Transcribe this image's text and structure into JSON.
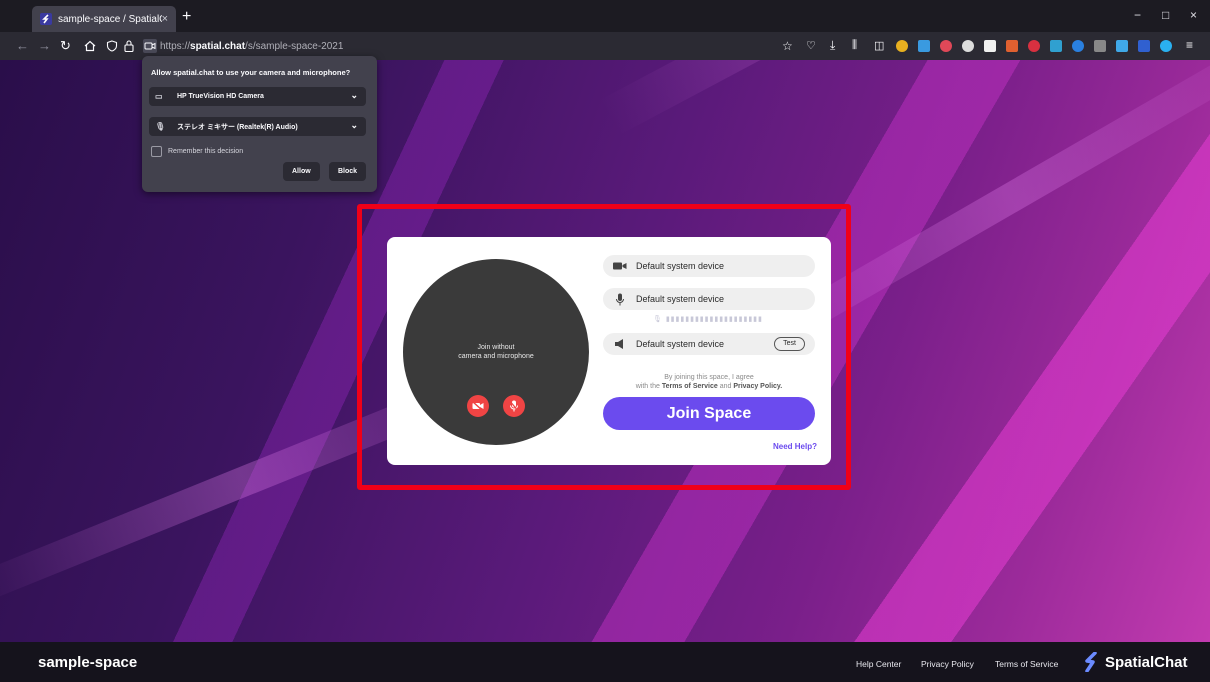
{
  "browser": {
    "tab_title": "sample-space / SpatialChat",
    "tab_close": "×",
    "new_tab": "+",
    "url_prefix": "https://",
    "url_host": "spatial.chat",
    "url_path": "/s/sample-space-2021",
    "window_controls": {
      "minimize": "−",
      "maximize": "□",
      "close": "×"
    }
  },
  "permission_popup": {
    "title": "Allow spatial.chat to use your camera and microphone?",
    "camera_select": "HP TrueVision HD Camera",
    "mic_select": "ステレオ ミキサー (Realtek(R) Audio)",
    "remember_label": "Remember this decision",
    "allow_label": "Allow",
    "block_label": "Block"
  },
  "join_card": {
    "preview_line1": "Join without",
    "preview_line2": "camera and microphone",
    "camera_device": "Default system device",
    "mic_device": "Default system device",
    "speaker_device": "Default system device",
    "test_label": "Test",
    "agree_line1": "By joining this space, I agree",
    "agree_prefix": "with the",
    "terms_link": "Terms of Service",
    "and_word": "and",
    "privacy_link": "Privacy Policy.",
    "join_label": "Join Space",
    "need_help": "Need Help?"
  },
  "footer": {
    "space_name": "sample-space",
    "links": [
      "Help Center",
      "Privacy Policy",
      "Terms of Service"
    ],
    "brand": "SpatialChat"
  },
  "colors": {
    "accent": "#6b4bee",
    "highlight": "#f00018",
    "mute_red": "#f04444"
  }
}
